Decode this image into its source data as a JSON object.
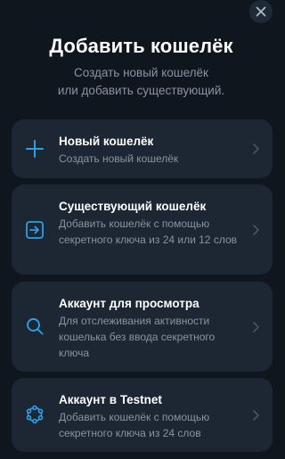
{
  "header": {
    "title": "Добавить кошелёк",
    "subtitle_line1": "Создать новый кошелёк",
    "subtitle_line2": "или добавить существующий."
  },
  "icons": {
    "close": "close-icon",
    "accent": "#2aa1e6"
  },
  "options": [
    {
      "title": "Новый кошелёк",
      "desc": "Создать новый кошелёк",
      "icon": "plus-icon"
    },
    {
      "title": "Существующий кошелёк",
      "desc": "Добавить кошелёк с помощью секретного ключа из 24 или 12 слов",
      "icon": "import-icon"
    },
    {
      "title": "Аккаунт для просмотра",
      "desc": "Для отслеживания активности кошелька без ввода секретного ключа",
      "icon": "search-icon"
    },
    {
      "title": "Аккаунт в Testnet",
      "desc": "Добавить кошелёк с помощью секретного ключа из 24 слов",
      "icon": "testnet-icon"
    }
  ]
}
